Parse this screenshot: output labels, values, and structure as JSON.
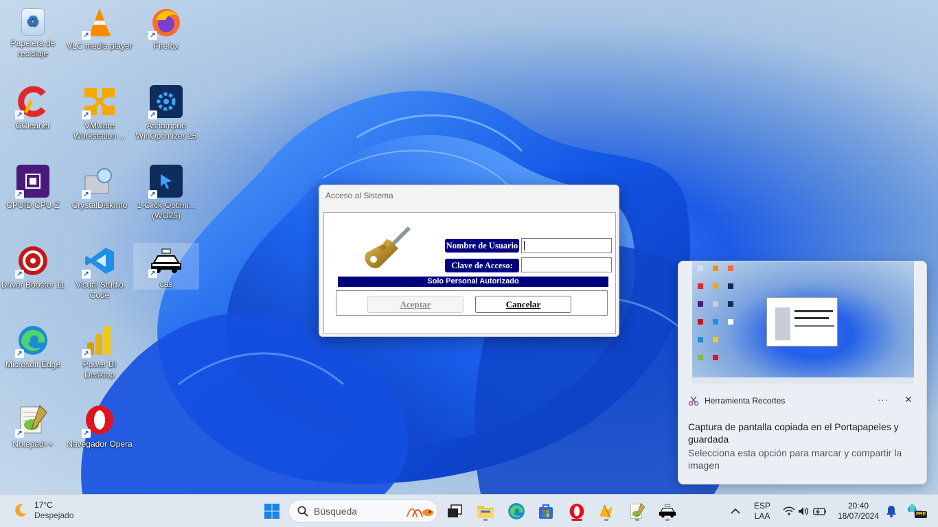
{
  "desktop": {
    "icons": [
      {
        "label": "Papelera de reciclaje",
        "icon": "recycle-bin-icon"
      },
      {
        "label": "VLC media player",
        "icon": "vlc-icon"
      },
      {
        "label": "Firefox",
        "icon": "firefox-icon"
      },
      {
        "label": "CCleaner",
        "icon": "ccleaner-icon"
      },
      {
        "label": "VMware Workstation ...",
        "icon": "vmware-icon"
      },
      {
        "label": "Ashampoo WinOptimizer 25",
        "icon": "ashampoo-icon"
      },
      {
        "label": "CPUID CPU-Z",
        "icon": "cpuz-icon"
      },
      {
        "label": "CrystalDiskInfo",
        "icon": "crystaldiskinfo-icon"
      },
      {
        "label": "1-Click-Optimi... (WO25)",
        "icon": "oneclick-icon"
      },
      {
        "label": "Driver Booster 11",
        "icon": "driver-booster-icon"
      },
      {
        "label": "Visual Studio Code",
        "icon": "vscode-icon"
      },
      {
        "label": "cas",
        "icon": "taxi-icon"
      },
      {
        "label": "Microsoft Edge",
        "icon": "edge-icon"
      },
      {
        "label": "Power BI Desktop",
        "icon": "powerbi-icon"
      },
      {
        "label": "Notepad++",
        "icon": "notepadpp-icon"
      },
      {
        "label": "Navegador Opera",
        "icon": "opera-icon"
      }
    ]
  },
  "dialog": {
    "title": "Acceso al Sistema",
    "username_label": "Nombre de Usuario",
    "username_value": "",
    "password_label": "Clave de Acceso:",
    "password_value": "",
    "banner": "Solo Personal Autorizado",
    "accept_label": "Aceptar",
    "cancel_label": "Cancelar"
  },
  "toast": {
    "app_name": "Herramienta Recortes",
    "more": "···",
    "message": "Captura de pantalla copiada en el Portapapeles y guardada",
    "sub": "Selecciona esta opción para marcar y compartir la imagen"
  },
  "taskbar": {
    "weather_temp": "17°C",
    "weather_desc": "Despejado",
    "search_placeholder": "Búsqueda",
    "lang_top": "ESP",
    "lang_bottom": "LAA",
    "time": "20:40",
    "date": "18/07/2024",
    "copilot_badge": "PRE"
  },
  "colors": {
    "dialog_label_bg": "#00007E",
    "taskbar_bg": "#DFE7F1",
    "toast_bg": "#EBEFF5"
  }
}
